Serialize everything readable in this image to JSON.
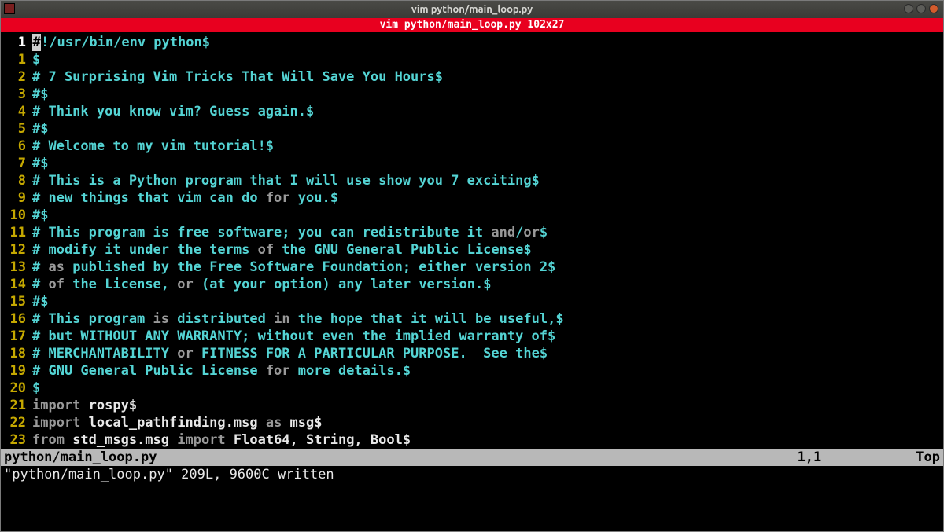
{
  "window": {
    "title": "vim python/main_loop.py"
  },
  "redbar": {
    "text": "vim python/main_loop.py 102x27"
  },
  "gutter": {
    "current": "1",
    "rel": [
      "1",
      "2",
      "3",
      "4",
      "5",
      "6",
      "7",
      "8",
      "9",
      "10",
      "11",
      "12",
      "13",
      "14",
      "15",
      "16",
      "17",
      "18",
      "19",
      "20",
      "21",
      "22",
      "23"
    ]
  },
  "cursor_char": "#",
  "lines": {
    "l0_rest": "!/usr/bin/env python$",
    "l1": "$",
    "l2": "# 7 Surprising Vim Tricks That Will Save You Hours$",
    "l3": "#$",
    "l4": "# Think you know vim? Guess again.$",
    "l5": "#$",
    "l6": "# Welcome to my vim tutorial!$",
    "l7": "#$",
    "l8": "# This is a Python program that I will use show you 7 exciting$",
    "l9a": "# new things that vim can do ",
    "l9_for": "for",
    "l9b": " you.$",
    "l10": "#$",
    "l11a": "# This program is free software; you can redistribute it ",
    "l11_and": "and",
    "l11b": "/",
    "l11_or": "or",
    "l11c": "$",
    "l12a": "# modify it under the terms ",
    "l12_of": "of",
    "l12b": " the GNU General Public License$",
    "l13a": "# ",
    "l13_as": "as",
    "l13b": " published by the Free Software Foundation; either version 2$",
    "l14a": "# ",
    "l14_of": "of",
    "l14b": " the License, ",
    "l14_or": "or",
    "l14c": " (at your option) any later version.$",
    "l15": "#$",
    "l16a": "# This program ",
    "l16_is": "is",
    "l16b": " distributed ",
    "l16_in": "in",
    "l16c": " the hope that it will be useful,$",
    "l17": "# but WITHOUT ANY WARRANTY; without even the implied warranty of$",
    "l18a": "# MERCHANTABILITY ",
    "l18_or": "or",
    "l18b": " FITNESS FOR A PARTICULAR PURPOSE.  See the$",
    "l19a": "# GNU General Public License ",
    "l19_for": "for",
    "l19b": " more details.$",
    "l20": "$",
    "l21_import": "import",
    "l21_rest": " rospy$",
    "l22_import": "import",
    "l22_mid": " local_pathfinding.msg ",
    "l22_as": "as",
    "l22_rest": " msg$",
    "l23_from": "from",
    "l23_mid": " std_msgs.msg ",
    "l23_import": "import",
    "l23_rest": " Float64, String, Bool$"
  },
  "status": {
    "file": "python/main_loop.py",
    "pos": "1,1",
    "scroll": "Top"
  },
  "message": "\"python/main_loop.py\" 209L, 9600C written"
}
